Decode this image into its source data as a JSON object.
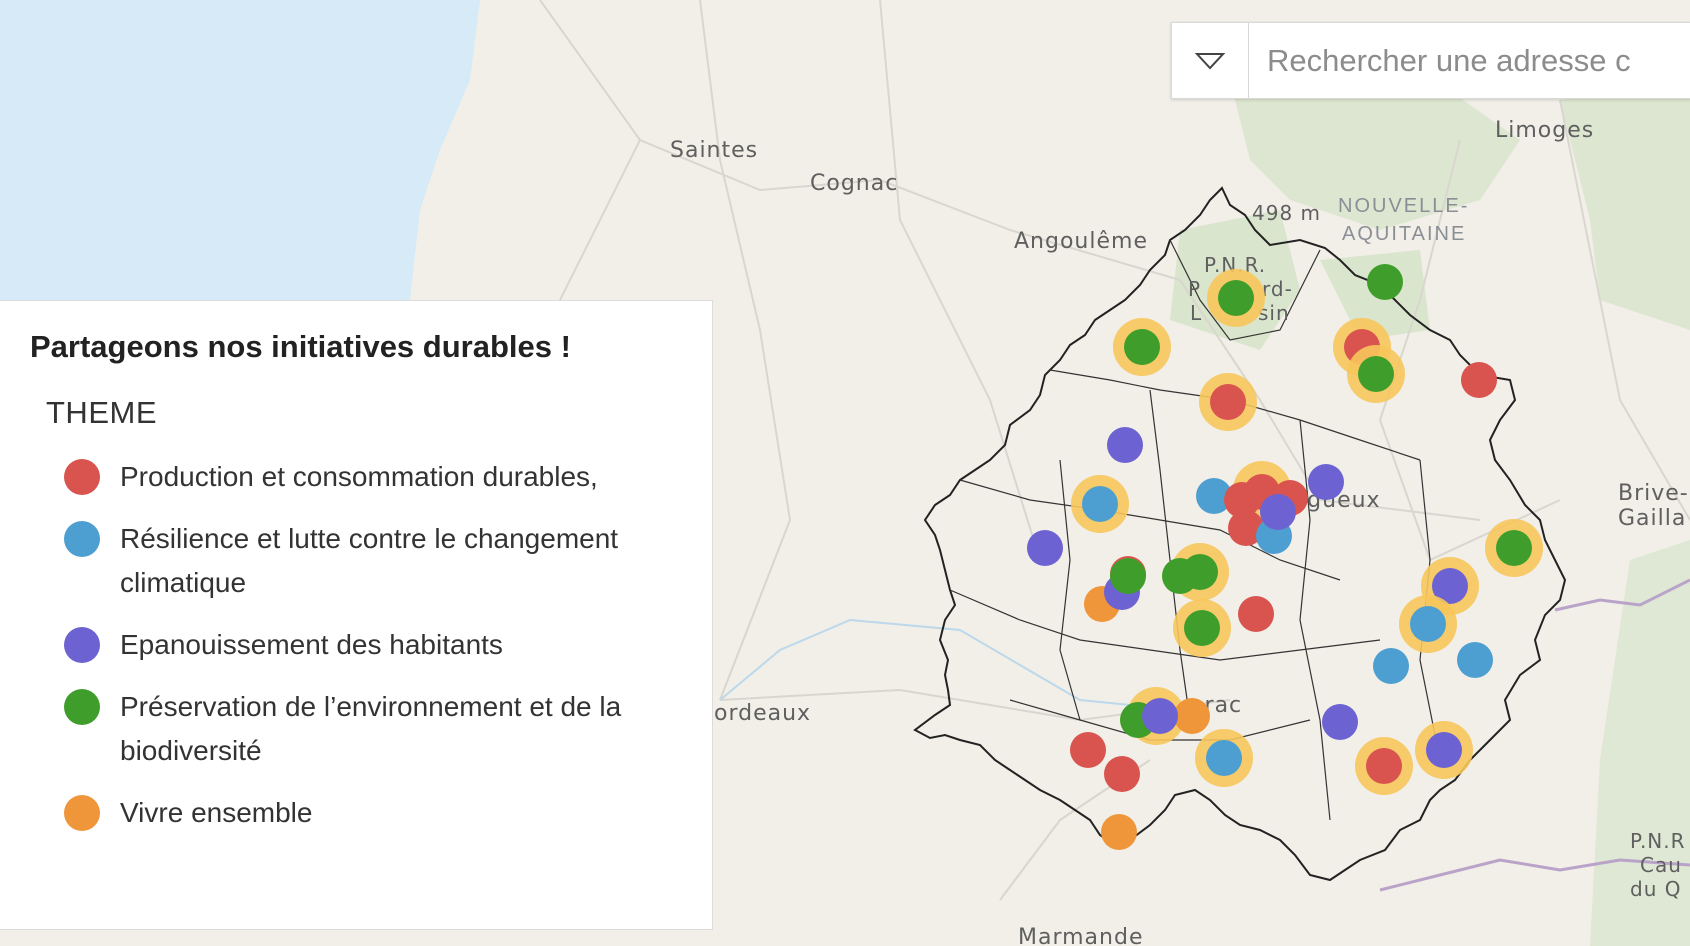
{
  "map": {
    "places": [
      {
        "name": "Saintes"
      },
      {
        "name": "Cognac"
      },
      {
        "name": "Angoulême"
      },
      {
        "name": "Limoges"
      },
      {
        "name": "Brive-"
      },
      {
        "name": "Gailla"
      },
      {
        "name": "ordeaux"
      },
      {
        "name": "erac"
      },
      {
        "name": "rigueux"
      },
      {
        "name": "Marmande"
      },
      {
        "name": "498 m"
      }
    ],
    "region": [
      "NOUVELLE-",
      "AQUITAINE"
    ],
    "park_label": [
      "P.N.R.",
      "P",
      "rd-",
      "L",
      "sin"
    ],
    "park_right": [
      "P.N.R",
      "Cau",
      "du Q"
    ]
  },
  "search": {
    "placeholder": "Rechercher une adresse c",
    "dropdown_icon": "chevron-down-icon"
  },
  "legend": {
    "title": "Partageons nos initiatives durables !",
    "subtitle": "THEME",
    "items": [
      {
        "label": "Production et consommation durables,",
        "color": "#d9534f"
      },
      {
        "label": "Résilience et lutte contre le changement climatique",
        "color": "#4e9fd1"
      },
      {
        "label": "Epanouissement des habitants",
        "color": "#6d62d1"
      },
      {
        "label": "Préservation de l’environnement et de la biodiversité",
        "color": "#3f9e2b"
      },
      {
        "label": "Vivre ensemble",
        "color": "#ef953a"
      }
    ]
  },
  "colors": {
    "sea": "#d6ebf7",
    "land": "#f1efe8",
    "forest": "#d4e2c6",
    "halo": "#f7c65b"
  }
}
